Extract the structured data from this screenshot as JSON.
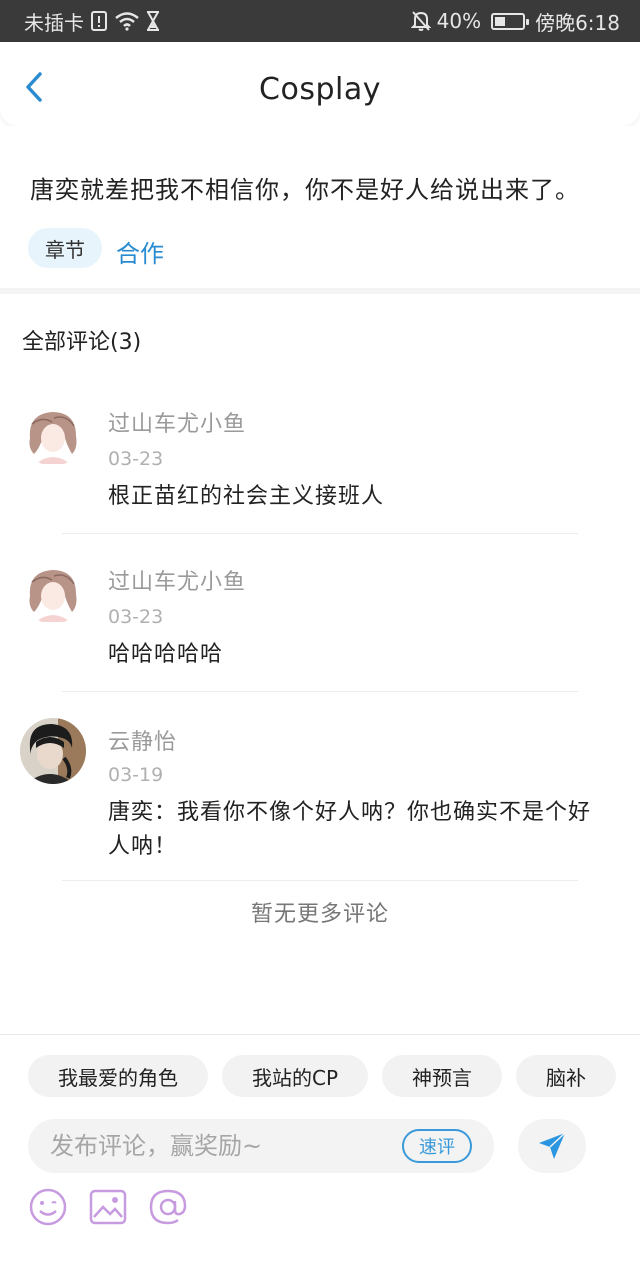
{
  "status_bar": {
    "carrier": "未插卡",
    "battery_percent": "40%",
    "battery_level": 0.4,
    "time": "傍晚6:18"
  },
  "header": {
    "title": "Cosplay"
  },
  "post": {
    "text": "唐奕就差把我不相信你，你不是好人给说出来了。",
    "chapter_tag": "章节",
    "chapter_name": "合作"
  },
  "comments_section": {
    "title": "全部评论(3)",
    "comments": [
      {
        "name": "过山车尤小鱼",
        "date": "03-23",
        "text": "根正苗红的社会主义接班人"
      },
      {
        "name": "过山车尤小鱼",
        "date": "03-23",
        "text": "哈哈哈哈哈"
      },
      {
        "name": "云静怡",
        "date": "03-19",
        "text": "唐奕：我看你不像个好人呐？你也确实不是个好人呐！"
      }
    ],
    "no_more": "暂无更多评论"
  },
  "bottom_bar": {
    "quick_tags": [
      "我最爱的角色",
      "我站的CP",
      "神预言",
      "脑补"
    ],
    "input_placeholder": "发布评论，赢奖励~",
    "quick_comment_label": "速评",
    "accent_color": "#3a9ad9",
    "icons": [
      "emoji-icon",
      "image-icon",
      "at-icon"
    ]
  }
}
